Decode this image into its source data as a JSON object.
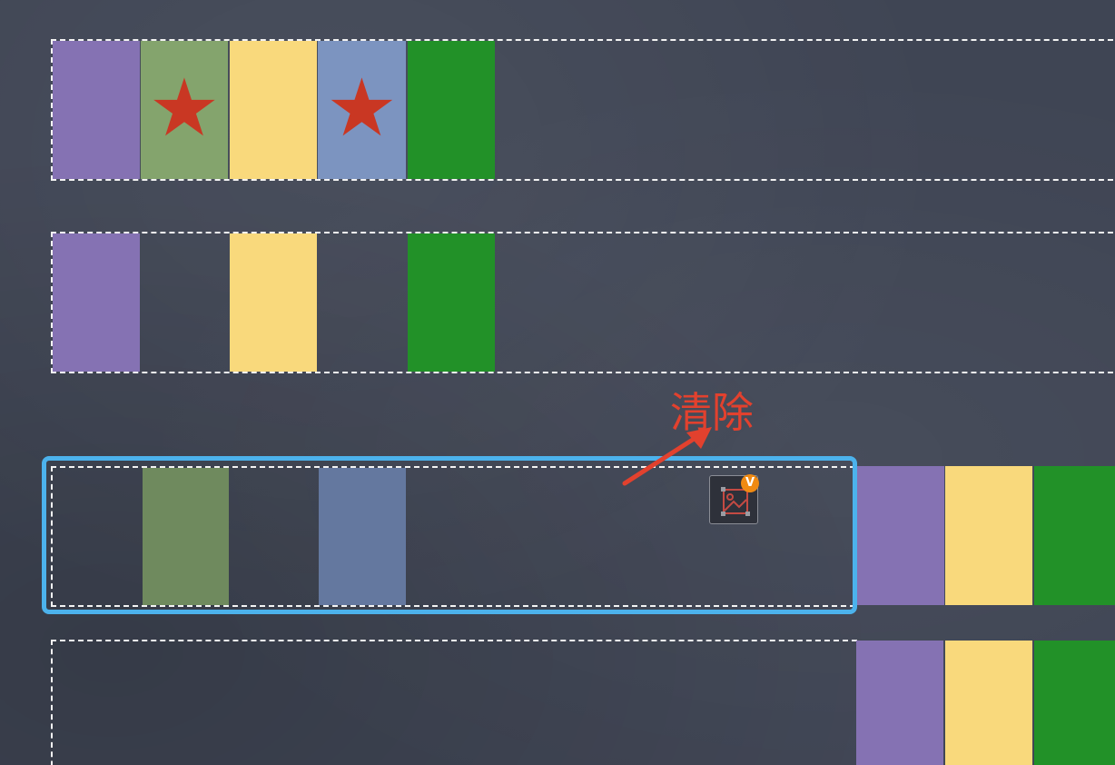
{
  "rows": [
    {
      "name": "row-1",
      "cells": [
        {
          "color": "purple",
          "marker": ""
        },
        {
          "color": "sage",
          "marker": "★"
        },
        {
          "color": "yellow",
          "marker": ""
        },
        {
          "color": "steel",
          "marker": "★"
        },
        {
          "color": "green",
          "marker": ""
        }
      ]
    },
    {
      "name": "row-2",
      "cells": [
        {
          "color": "purple",
          "marker": ""
        },
        {
          "color": "empty",
          "marker": ""
        },
        {
          "color": "yellow",
          "marker": ""
        },
        {
          "color": "empty",
          "marker": ""
        },
        {
          "color": "green",
          "marker": ""
        }
      ]
    },
    {
      "name": "row-3",
      "cells": [
        {
          "color": "empty"
        },
        {
          "color": "faded-sage"
        },
        {
          "color": "empty"
        },
        {
          "color": "faded-steel"
        },
        {
          "color": "empty"
        }
      ],
      "overflow_cells": [
        {
          "color": "purple"
        },
        {
          "color": "yellow"
        },
        {
          "color": "green"
        }
      ]
    },
    {
      "name": "row-4",
      "overflow_cells": [
        {
          "color": "purple"
        },
        {
          "color": "yellow"
        },
        {
          "color": "green"
        }
      ]
    }
  ],
  "annotation": {
    "label": "清除",
    "color": "#e2412e",
    "highlight_color": "#4cb2ec"
  },
  "image_button": {
    "icon": "image-icon",
    "badge": "V",
    "badge_color": "#f08a12"
  },
  "colors": {
    "background": "#3f4554",
    "purple": "#8572b3",
    "sage": "#84a46d",
    "yellow": "#f9d97c",
    "steel": "#7c94c0",
    "green": "#229128",
    "star": "#c93723"
  }
}
